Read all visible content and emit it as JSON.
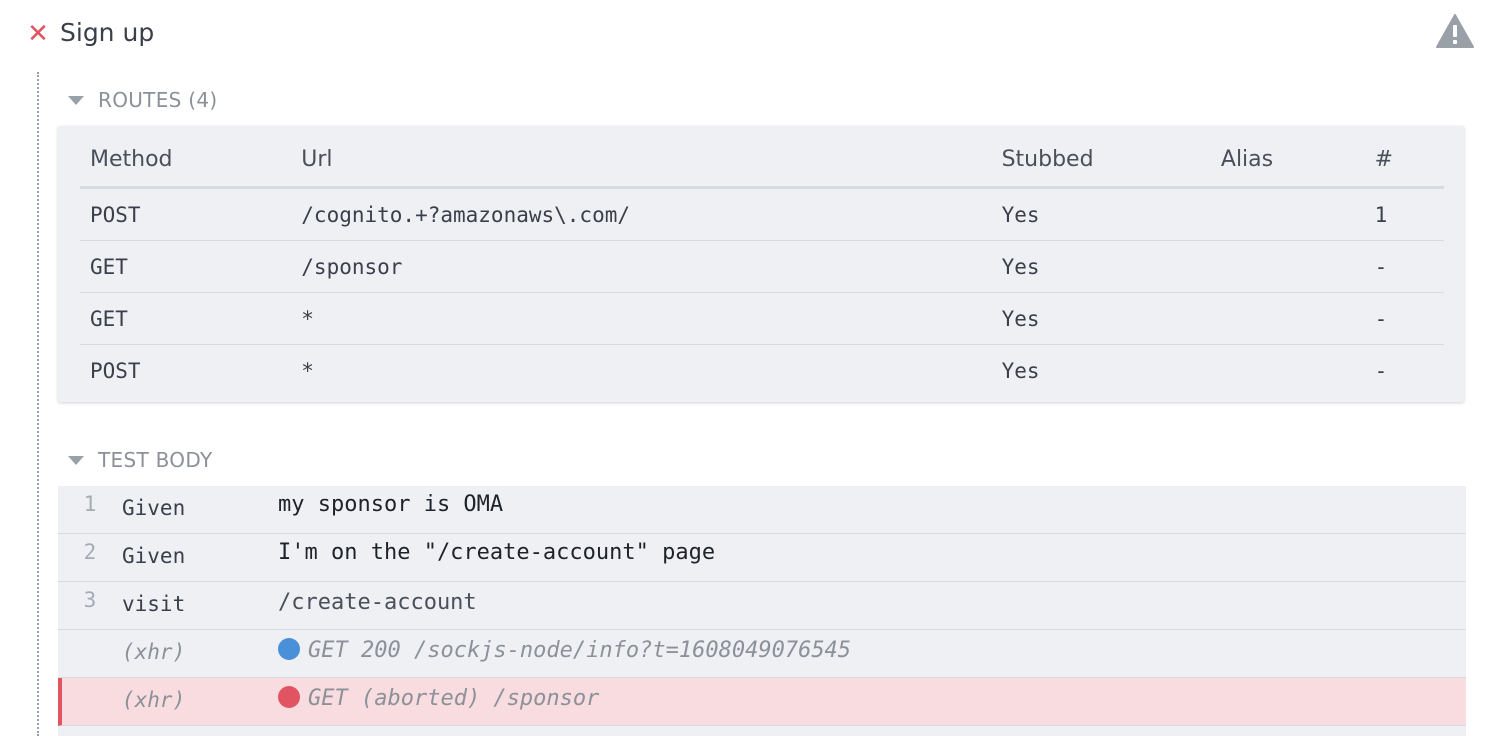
{
  "header": {
    "title": "Sign up",
    "fail_icon": "✕",
    "fail_color": "#e05561",
    "warning_icon": "warning-triangle-icon"
  },
  "routes": {
    "label": "ROUTES (4)",
    "columns": [
      "Method",
      "Url",
      "Stubbed",
      "Alias",
      "#"
    ],
    "rows": [
      {
        "method": "POST",
        "url": "/cognito.+?amazonaws\\.com/",
        "stubbed": "Yes",
        "alias": "",
        "count": "1"
      },
      {
        "method": "GET",
        "url": "/sponsor",
        "stubbed": "Yes",
        "alias": "",
        "count": "-"
      },
      {
        "method": "GET",
        "url": "*",
        "stubbed": "Yes",
        "alias": "",
        "count": "-"
      },
      {
        "method": "POST",
        "url": "*",
        "stubbed": "Yes",
        "alias": "",
        "count": "-"
      }
    ]
  },
  "test_body": {
    "label": "TEST BODY",
    "commands": [
      {
        "num": "1",
        "name": "Given",
        "message": "my sponsor is OMA"
      },
      {
        "num": "2",
        "name": "Given",
        "message": "I'm on the \"/create-account\" page"
      },
      {
        "num": "3",
        "name": "visit",
        "message": "/create-account"
      },
      {
        "num": "",
        "name": "(xhr)",
        "message": "GET 200 /sockjs-node/info?t=1608049076545",
        "dot_color": "#4a90d9"
      },
      {
        "num": "",
        "name": "(xhr)",
        "message": "GET (aborted) /sponsor",
        "dot_color": "#e05561",
        "failed": true
      }
    ]
  }
}
